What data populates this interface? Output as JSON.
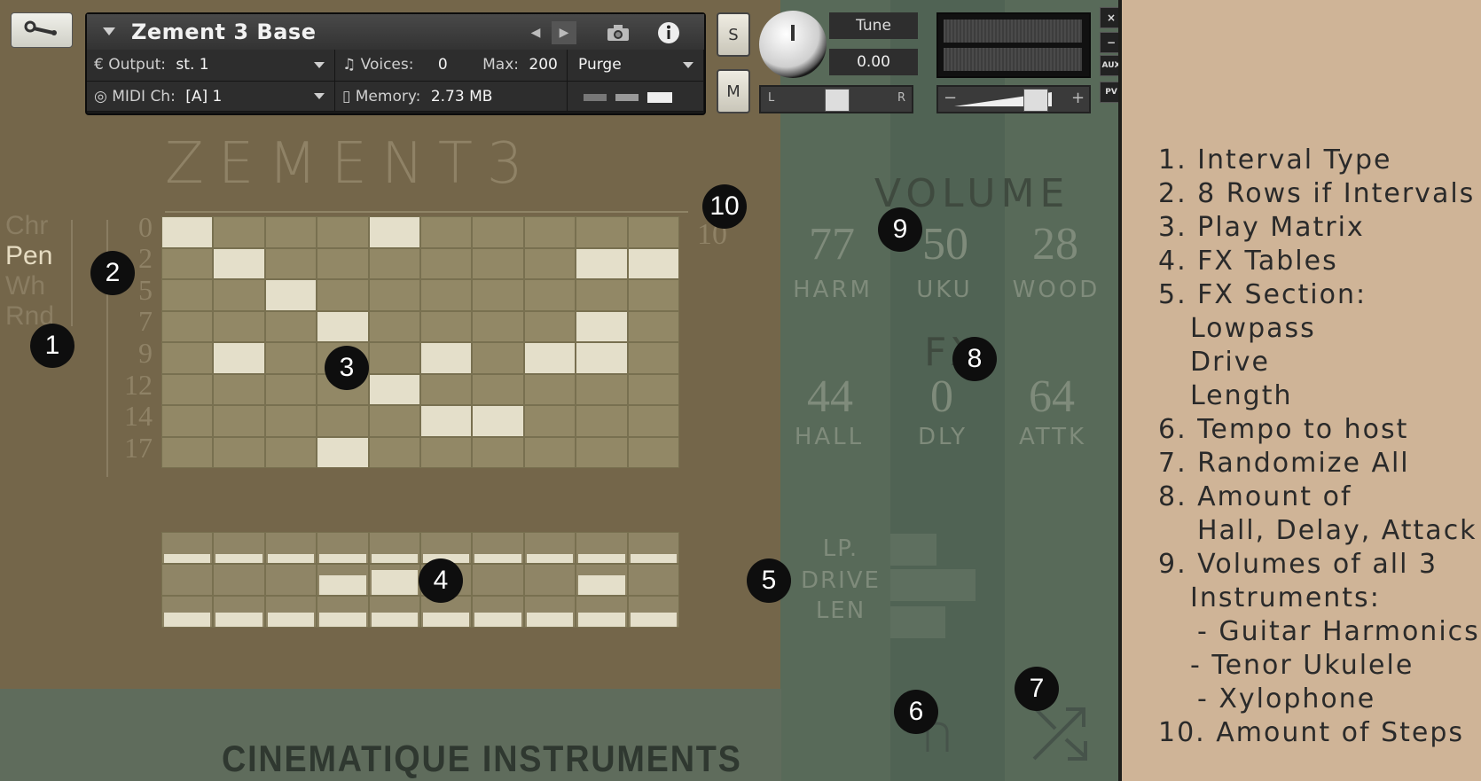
{
  "header": {
    "instrument_name": "Zement 3 Base",
    "output_label": "Output:",
    "output_value": "st. 1",
    "midi_label": "MIDI Ch:",
    "midi_value": "[A]  1",
    "voices_label": "Voices:",
    "voices_value": "0",
    "max_label": "Max:",
    "max_value": "200",
    "memory_label": "Memory:",
    "memory_value": "2.73 MB",
    "purge_label": "Purge",
    "tune_label": "Tune",
    "tune_value": "0.00",
    "solo_label": "S",
    "mute_label": "M",
    "pan_left": "L",
    "pan_right": "R",
    "vol_minus": "−",
    "vol_plus": "+",
    "aux_label": "AUX",
    "pv_label": "PV",
    "close_label": "×",
    "minimize_label": "−"
  },
  "main": {
    "logo": "ZEMENT3",
    "interval_types": [
      "Chr",
      "Pen",
      "Wh",
      "Rnd"
    ],
    "selected_interval": "Pen",
    "row_labels": [
      "0",
      "2",
      "5",
      "7",
      "9",
      "12",
      "14",
      "17"
    ],
    "steps": "10",
    "volume_title": "VOLUME",
    "volumes": [
      {
        "value": "77",
        "label": "HARM"
      },
      {
        "value": "50",
        "label": "UKU"
      },
      {
        "value": "28",
        "label": "WOOD"
      }
    ],
    "fx_title": "FX",
    "fx_amounts": [
      {
        "value": "44",
        "label": "HALL"
      },
      {
        "value": "0",
        "label": "DLY"
      },
      {
        "value": "64",
        "label": "ATTK"
      }
    ],
    "fx_section": [
      "LP.",
      "DRIVE",
      "LEN"
    ],
    "brand": "CINEMATIQUE INSTRUMENTS"
  },
  "matrix": {
    "columns": 10,
    "rows": 8,
    "active_rows_by_step": [
      0,
      1,
      2,
      3,
      0,
      4,
      6,
      4,
      1,
      1
    ],
    "extra_active": [
      [
        1,
        4
      ],
      [
        3,
        7
      ],
      [
        4,
        5
      ],
      [
        5,
        6
      ],
      [
        8,
        3
      ],
      [
        8,
        4
      ]
    ]
  },
  "markers": [
    "1",
    "2",
    "3",
    "4",
    "5",
    "6",
    "7",
    "8",
    "9",
    "10"
  ],
  "legend": [
    "1. Interval Type",
    "2. 8 Rows if Intervals",
    "3. Play Matrix",
    "4. FX Tables",
    "5. FX Section:",
    "Lowpass",
    "Drive",
    "Length",
    "6. Tempo to host",
    "7. Randomize All",
    "8. Amount of",
    "Hall, Delay, Attack",
    "9. Volumes of all 3",
    "Instruments:",
    "- Guitar Harmonics",
    "- Tenor Ukulele",
    "- Xylophone",
    "10. Amount of Steps"
  ],
  "colors": {
    "instrument_bg": "#74664a",
    "green_panel": "#586a59",
    "legend_bg": "#cfb497",
    "cell_on": "#e4dfca"
  }
}
